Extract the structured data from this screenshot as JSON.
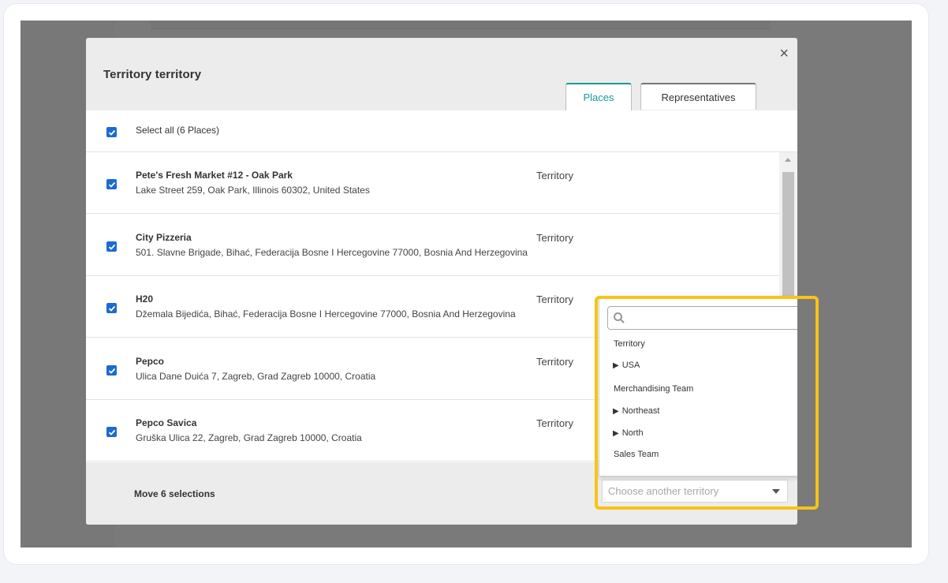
{
  "modal": {
    "title": "Territory territory",
    "close_glyph": "×",
    "tabs": [
      {
        "label": "Places",
        "active": true
      },
      {
        "label": "Representatives",
        "active": false
      }
    ],
    "select_all_label": "Select all (6 Places)",
    "rows": [
      {
        "name": "Pete's Fresh Market #12 - Oak Park",
        "address": "Lake Street 259, Oak Park, Illinois 60302, United States",
        "territory": "Territory",
        "checked": true
      },
      {
        "name": "City Pizzeria",
        "address": "501. Slavne Brigade, Bihać, Federacija Bosne I Hercegovine 77000, Bosnia And Herzegovina",
        "territory": "Territory",
        "checked": true
      },
      {
        "name": "H20",
        "address": "Džemala Bijedića, Bihać, Federacija Bosne I Hercegovine 77000, Bosnia And Herzegovina",
        "territory": "Territory",
        "checked": true
      },
      {
        "name": "Pepco",
        "address": "Ulica Dane Duića 7, Zagreb, Grad Zagreb 10000, Croatia",
        "territory": "Territory",
        "checked": true
      },
      {
        "name": "Pepco Savica",
        "address": "Gruška Ulica 22, Zagreb, Grad Zagreb 10000, Croatia",
        "territory": "Territory",
        "checked": true
      }
    ],
    "footer": {
      "move_label": "Move 6 selections",
      "select_placeholder": "Choose another territory"
    },
    "dropdown": {
      "search_value": "",
      "options": [
        {
          "label": "Territory",
          "expandable": false
        },
        {
          "label": "USA",
          "expandable": true
        },
        {
          "label": "Merchandising Team",
          "expandable": false
        },
        {
          "label": "Northeast",
          "expandable": true
        },
        {
          "label": "North",
          "expandable": true
        },
        {
          "label": "Sales Team",
          "expandable": false
        }
      ]
    }
  },
  "colors": {
    "accent": "#1b9a95",
    "checkbox": "#1b6bd1",
    "highlight": "#f5c518",
    "overlay": "#7a7a7a"
  }
}
